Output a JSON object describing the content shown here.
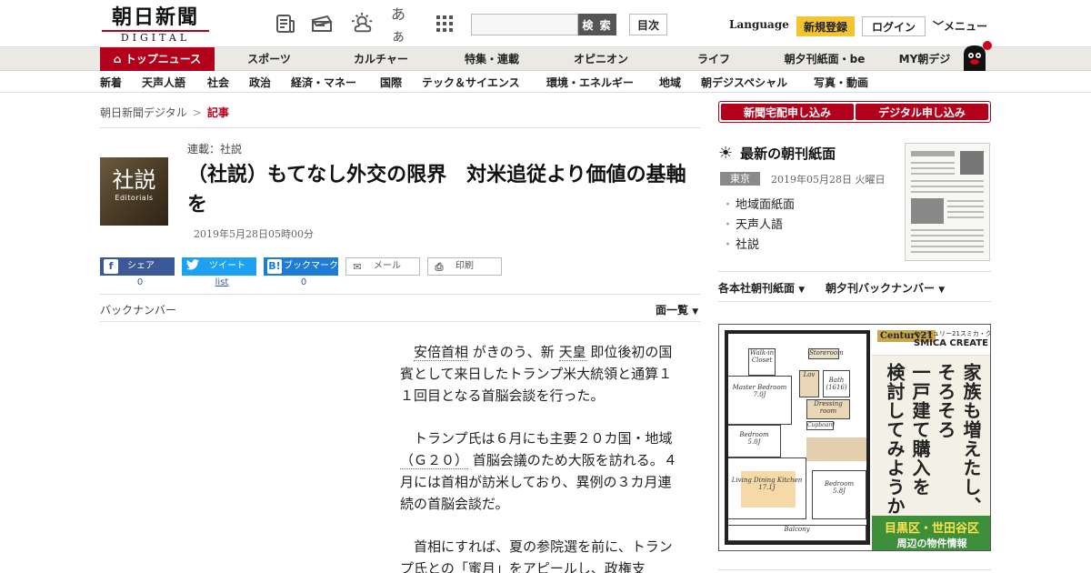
{
  "header": {
    "logo_main": "朝日新聞",
    "logo_sub": "DIGITAL",
    "search_placeholder": "",
    "search_button": "検 索",
    "toc_button": "目次",
    "font_size_icon_label": "あぁ",
    "language": "Language",
    "signup": "新規登録",
    "login": "ログイン",
    "menu": "メニュー"
  },
  "icons": [
    "newspaper-icon",
    "ticket-icon",
    "weather-icon",
    "font-size-icon",
    "grid-icon",
    "home-icon",
    "chevron-down-icon",
    "facebook-icon",
    "twitter-icon",
    "hatena-icon",
    "mail-icon",
    "print-icon",
    "sun-icon"
  ],
  "nav1": [
    {
      "label": "トップニュース"
    },
    {
      "label": "スポーツ"
    },
    {
      "label": "カルチャー"
    },
    {
      "label": "特集・連載"
    },
    {
      "label": "オピニオン"
    },
    {
      "label": "ライフ"
    },
    {
      "label": "朝夕刊紙面・be"
    },
    {
      "label": "MY朝デジ"
    }
  ],
  "nav2": [
    "新着",
    "天声人語",
    "社会",
    "政治",
    "経済・マネー",
    "国際",
    "テック＆サイエンス",
    "環境・エネルギー",
    "地域",
    "朝デジスペシャル",
    "写真・動画"
  ],
  "breadcrumb": {
    "home": "朝日新聞デジタル",
    "sep": ">",
    "current": "記事"
  },
  "article": {
    "thumb_kanji": "社説",
    "thumb_en": "Editorials",
    "series": "連載：社説",
    "title": "（社説）もてなし外交の限界　対米追従より価値の基軸を",
    "date": "2019年5月28日05時00分",
    "share": {
      "fb": "シェア",
      "fb_count": "0",
      "tw": "ツイート",
      "tw_count": "list",
      "hb": "ブックマーク",
      "hb_count": "0",
      "mail": "メール",
      "print": "印刷"
    },
    "backnumber": "バックナンバー",
    "menlist": "面一覧",
    "p1_kw1": "安倍首相",
    "p1_a": "がきのう、新",
    "p1_kw2": "天皇",
    "p1_b": "即位後初の国賓として来日したトランプ米大統領と通算１１回目となる首脳会談を行った。",
    "p2_a": "トランプ氏は６月にも主要２０カ国・地域",
    "p2_kw": "（Ｇ２０）",
    "p2_b": "首脳会議のため大阪を訪れる。４月には首相が訪米しており、異例の３カ月連続の首脳会談だ。",
    "p3": "首相にすれば、夏の参院選を前に、トランプ氏との「蜜月」をアピールし、政権支"
  },
  "sidebar": {
    "sub_home": "新聞宅配申し込み",
    "sub_digital": "デジタル申し込み",
    "title": "最新の朝刊紙面",
    "region": "東京",
    "date": "2019年05月28日 火曜日",
    "links": [
      "地域面紙面",
      "天声人語",
      "社説"
    ],
    "sel1": "各本社朝刊紙面",
    "sel2": "朝夕刊バックナンバー"
  },
  "ad": {
    "brand": "Century21",
    "brand_sub": "センチュリー21スミカ・クリエイト",
    "brand_name": "SMICA CREATE",
    "copy_cols": [
      "家族も増えたし、",
      "そろそろ",
      "一戸建て購入を",
      "検討してみようか。"
    ],
    "area": "目黒区・世田谷区",
    "area_sub": "周辺の物件情報",
    "rooms": {
      "walkin": "Walk-in Closet",
      "storeroom": "Storeroom",
      "master": "Master Bedroom",
      "master_size": "7.0J",
      "bedroom1": "Bedroom",
      "bedroom1_size": "5.0J",
      "living": "Living Dining Kitchen",
      "living_size": "17.1J",
      "bedroom2": "Bedroom",
      "bedroom2_size": "5.8J",
      "lav": "Lav",
      "bath": "Bath",
      "bath_size": "(1616)",
      "dressing": "Dressing room",
      "cupboard": "Cupboard",
      "balcony": "Balcony"
    }
  },
  "colors": {
    "brand_red": "#b3001b",
    "signup_yellow": "#f5c531",
    "facebook": "#3b5998",
    "twitter": "#1da1f2",
    "hatena": "#1e7cd6",
    "ad_green": "#3d8f3a"
  }
}
